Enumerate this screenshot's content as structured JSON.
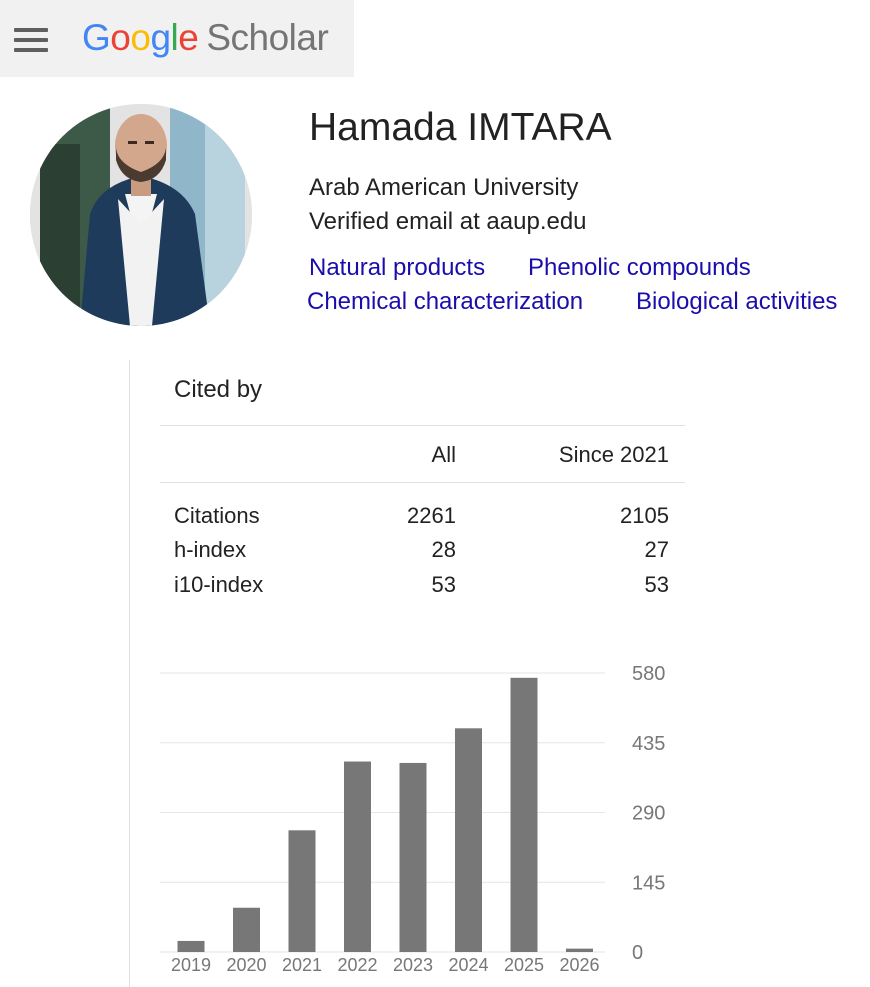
{
  "header": {
    "logo_letters": [
      "G",
      "o",
      "o",
      "g",
      "l",
      "e"
    ],
    "logo_product": "Scholar",
    "menu_icon": "hamburger-menu-icon"
  },
  "profile": {
    "name": "Hamada IMTARA",
    "affiliation": "Arab American University",
    "email_note": "Verified email at aaup.edu",
    "interests": [
      "Natural products",
      "Phenolic compounds",
      "Chemical characterization",
      "Biological activities"
    ],
    "link_color": "#1a0dab"
  },
  "cited_by": {
    "title": "Cited by",
    "columns": [
      "",
      "All",
      "Since 2021"
    ],
    "rows": [
      {
        "label": "Citations",
        "all": "2261",
        "since": "2105"
      },
      {
        "label": "h-index",
        "all": "28",
        "since": "27"
      },
      {
        "label": "i10-index",
        "all": "53",
        "since": "53"
      }
    ]
  },
  "chart_data": {
    "type": "bar",
    "title": "",
    "xlabel": "",
    "ylabel": "",
    "categories": [
      "2019",
      "2020",
      "2021",
      "2022",
      "2023",
      "2024",
      "2025",
      "2026"
    ],
    "values": [
      23,
      92,
      253,
      396,
      393,
      465,
      570,
      7
    ],
    "ylim": [
      0,
      580
    ],
    "yticks": [
      "0",
      "145",
      "290",
      "435",
      "580"
    ],
    "y_axis_side": "right",
    "grid": true,
    "bar_color": "#777777"
  }
}
